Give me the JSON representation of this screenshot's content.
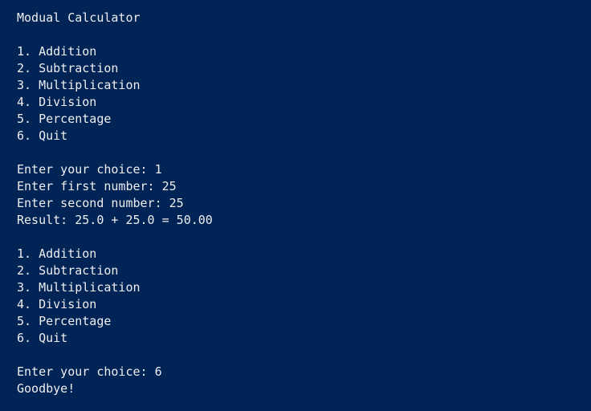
{
  "console": {
    "title": "Modual Calculator",
    "menu_first": [
      "1. Addition",
      "2. Subtraction",
      "3. Multiplication",
      "4. Division",
      "5. Percentage",
      "6. Quit"
    ],
    "session_1": {
      "choice": "Enter your choice: 1",
      "first_number": "Enter first number: 25",
      "second_number": "Enter second number: 25",
      "result": "Result: 25.0 + 25.0 = 50.00"
    },
    "menu_second": [
      "1. Addition",
      "2. Subtraction",
      "3. Multiplication",
      "4. Division",
      "5. Percentage",
      "6. Quit"
    ],
    "session_2": {
      "choice": "Enter your choice: 6",
      "farewell": "Goodbye!"
    }
  },
  "colors": {
    "background": "#012456",
    "text": "#eeeeee"
  }
}
